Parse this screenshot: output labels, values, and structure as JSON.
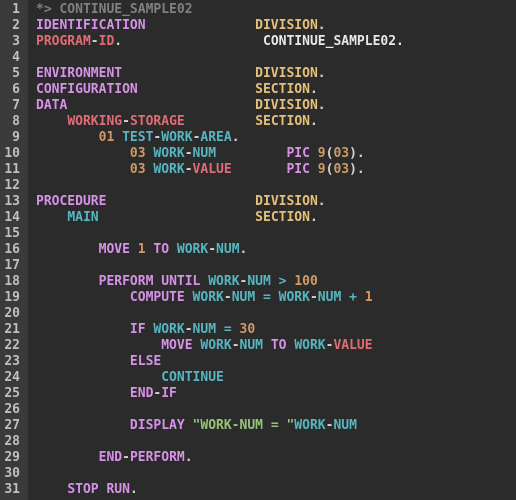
{
  "editor": {
    "line_count": 31,
    "lines": [
      {
        "n": 1,
        "tokens": [
          [
            "*> CONTINUE_SAMPLE02",
            "c-comment"
          ]
        ]
      },
      {
        "n": 2,
        "tokens": [
          [
            "IDENTIFICATION",
            "c-kw"
          ],
          [
            "              ",
            ""
          ],
          [
            "DIVISION",
            "c-division"
          ],
          [
            ".",
            ""
          ]
        ]
      },
      {
        "n": 3,
        "tokens": [
          [
            "PROGRAM",
            "c-id"
          ],
          [
            "-",
            ""
          ],
          [
            "ID",
            "c-id"
          ],
          [
            ".",
            ""
          ],
          [
            "                  ",
            ""
          ],
          [
            "CONTINUE_SAMPLE02.",
            "c-white"
          ]
        ]
      },
      {
        "n": 4,
        "tokens": []
      },
      {
        "n": 5,
        "tokens": [
          [
            "ENVIRONMENT",
            "c-kw"
          ],
          [
            "                 ",
            ""
          ],
          [
            "DIVISION",
            "c-division"
          ],
          [
            ".",
            ""
          ]
        ]
      },
      {
        "n": 6,
        "tokens": [
          [
            "CONFIGURATION",
            "c-kw"
          ],
          [
            "               ",
            ""
          ],
          [
            "SECTION",
            "c-section"
          ],
          [
            ".",
            ""
          ]
        ]
      },
      {
        "n": 7,
        "tokens": [
          [
            "DATA",
            "c-kw"
          ],
          [
            "                        ",
            ""
          ],
          [
            "DIVISION",
            "c-division"
          ],
          [
            ".",
            ""
          ]
        ]
      },
      {
        "n": 8,
        "tokens": [
          [
            "    ",
            ""
          ],
          [
            "WORKING",
            "c-id"
          ],
          [
            "-",
            ""
          ],
          [
            "STORAGE",
            "c-id"
          ],
          [
            "         ",
            ""
          ],
          [
            "SECTION",
            "c-section"
          ],
          [
            ".",
            ""
          ]
        ]
      },
      {
        "n": 9,
        "tokens": [
          [
            "        ",
            ""
          ],
          [
            "01",
            "c-num"
          ],
          [
            " ",
            ""
          ],
          [
            "TEST",
            "c-teal"
          ],
          [
            "-",
            ""
          ],
          [
            "WORK",
            "c-teal"
          ],
          [
            "-",
            ""
          ],
          [
            "AREA",
            "c-teal"
          ],
          [
            ".",
            ""
          ]
        ]
      },
      {
        "n": 10,
        "tokens": [
          [
            "            ",
            ""
          ],
          [
            "03",
            "c-num"
          ],
          [
            " ",
            ""
          ],
          [
            "WORK",
            "c-teal"
          ],
          [
            "-",
            ""
          ],
          [
            "NUM",
            "c-teal"
          ],
          [
            "         ",
            ""
          ],
          [
            "PIC",
            "c-kw"
          ],
          [
            " ",
            ""
          ],
          [
            "9",
            "c-num"
          ],
          [
            "(",
            ""
          ],
          [
            "03",
            "c-num"
          ],
          [
            ").",
            ""
          ]
        ]
      },
      {
        "n": 11,
        "tokens": [
          [
            "            ",
            ""
          ],
          [
            "03",
            "c-num"
          ],
          [
            " ",
            ""
          ],
          [
            "WORK",
            "c-teal"
          ],
          [
            "-",
            ""
          ],
          [
            "VALUE",
            "c-id"
          ],
          [
            "       ",
            ""
          ],
          [
            "PIC",
            "c-kw"
          ],
          [
            " ",
            ""
          ],
          [
            "9",
            "c-num"
          ],
          [
            "(",
            ""
          ],
          [
            "03",
            "c-num"
          ],
          [
            ").",
            ""
          ]
        ]
      },
      {
        "n": 12,
        "tokens": []
      },
      {
        "n": 13,
        "tokens": [
          [
            "PROCEDURE",
            "c-kw"
          ],
          [
            "                   ",
            ""
          ],
          [
            "DIVISION",
            "c-division"
          ],
          [
            ".",
            ""
          ]
        ]
      },
      {
        "n": 14,
        "tokens": [
          [
            "    ",
            ""
          ],
          [
            "MAIN",
            "c-teal"
          ],
          [
            "                    ",
            ""
          ],
          [
            "SECTION",
            "c-section"
          ],
          [
            ".",
            ""
          ]
        ]
      },
      {
        "n": 15,
        "tokens": []
      },
      {
        "n": 16,
        "tokens": [
          [
            "        ",
            ""
          ],
          [
            "MOVE",
            "c-kw"
          ],
          [
            " ",
            ""
          ],
          [
            "1",
            "c-num"
          ],
          [
            " ",
            ""
          ],
          [
            "TO",
            "c-kw"
          ],
          [
            " ",
            ""
          ],
          [
            "WORK",
            "c-teal"
          ],
          [
            "-",
            ""
          ],
          [
            "NUM",
            "c-teal"
          ],
          [
            ".",
            ""
          ]
        ]
      },
      {
        "n": 17,
        "tokens": []
      },
      {
        "n": 18,
        "tokens": [
          [
            "        ",
            ""
          ],
          [
            "PERFORM",
            "c-kw"
          ],
          [
            " ",
            ""
          ],
          [
            "UNTIL",
            "c-kw"
          ],
          [
            " ",
            ""
          ],
          [
            "WORK",
            "c-teal"
          ],
          [
            "-",
            ""
          ],
          [
            "NUM",
            "c-teal"
          ],
          [
            " ",
            ""
          ],
          [
            ">",
            "c-op"
          ],
          [
            " ",
            ""
          ],
          [
            "100",
            "c-num"
          ]
        ]
      },
      {
        "n": 19,
        "tokens": [
          [
            "            ",
            ""
          ],
          [
            "COMPUTE",
            "c-kw"
          ],
          [
            " ",
            ""
          ],
          [
            "WORK",
            "c-teal"
          ],
          [
            "-",
            ""
          ],
          [
            "NUM",
            "c-teal"
          ],
          [
            " ",
            ""
          ],
          [
            "=",
            "c-op"
          ],
          [
            " ",
            ""
          ],
          [
            "WORK",
            "c-teal"
          ],
          [
            "-",
            ""
          ],
          [
            "NUM",
            "c-teal"
          ],
          [
            " ",
            ""
          ],
          [
            "+",
            "c-op"
          ],
          [
            " ",
            ""
          ],
          [
            "1",
            "c-num"
          ]
        ]
      },
      {
        "n": 20,
        "tokens": []
      },
      {
        "n": 21,
        "tokens": [
          [
            "            ",
            ""
          ],
          [
            "IF",
            "c-kw"
          ],
          [
            " ",
            ""
          ],
          [
            "WORK",
            "c-teal"
          ],
          [
            "-",
            ""
          ],
          [
            "NUM",
            "c-teal"
          ],
          [
            " ",
            ""
          ],
          [
            "=",
            "c-op"
          ],
          [
            " ",
            ""
          ],
          [
            "30",
            "c-num"
          ]
        ]
      },
      {
        "n": 22,
        "tokens": [
          [
            "                ",
            ""
          ],
          [
            "MOVE",
            "c-kw"
          ],
          [
            " ",
            ""
          ],
          [
            "WORK",
            "c-teal"
          ],
          [
            "-",
            ""
          ],
          [
            "NUM",
            "c-teal"
          ],
          [
            " ",
            ""
          ],
          [
            "TO",
            "c-kw"
          ],
          [
            " ",
            ""
          ],
          [
            "WORK",
            "c-teal"
          ],
          [
            "-",
            ""
          ],
          [
            "VALUE",
            "c-id"
          ]
        ]
      },
      {
        "n": 23,
        "tokens": [
          [
            "            ",
            ""
          ],
          [
            "ELSE",
            "c-kw"
          ]
        ]
      },
      {
        "n": 24,
        "tokens": [
          [
            "                ",
            ""
          ],
          [
            "CONTINUE",
            "c-teal"
          ]
        ]
      },
      {
        "n": 25,
        "tokens": [
          [
            "            ",
            ""
          ],
          [
            "END",
            "c-kw"
          ],
          [
            "-",
            ""
          ],
          [
            "IF",
            "c-kw"
          ]
        ]
      },
      {
        "n": 26,
        "tokens": []
      },
      {
        "n": 27,
        "tokens": [
          [
            "            ",
            ""
          ],
          [
            "DISPLAY",
            "c-kw"
          ],
          [
            " ",
            ""
          ],
          [
            "\"WORK-NUM = \"",
            "c-str"
          ],
          [
            "WORK",
            "c-teal"
          ],
          [
            "-",
            ""
          ],
          [
            "NUM",
            "c-teal"
          ]
        ]
      },
      {
        "n": 28,
        "tokens": []
      },
      {
        "n": 29,
        "tokens": [
          [
            "        ",
            ""
          ],
          [
            "END",
            "c-kw"
          ],
          [
            "-",
            ""
          ],
          [
            "PERFORM",
            "c-kw"
          ],
          [
            ".",
            ""
          ]
        ]
      },
      {
        "n": 30,
        "tokens": []
      },
      {
        "n": 31,
        "tokens": [
          [
            "    ",
            ""
          ],
          [
            "STOP",
            "c-kw"
          ],
          [
            " ",
            ""
          ],
          [
            "RUN",
            "c-kw"
          ],
          [
            ".",
            ""
          ]
        ]
      }
    ]
  }
}
